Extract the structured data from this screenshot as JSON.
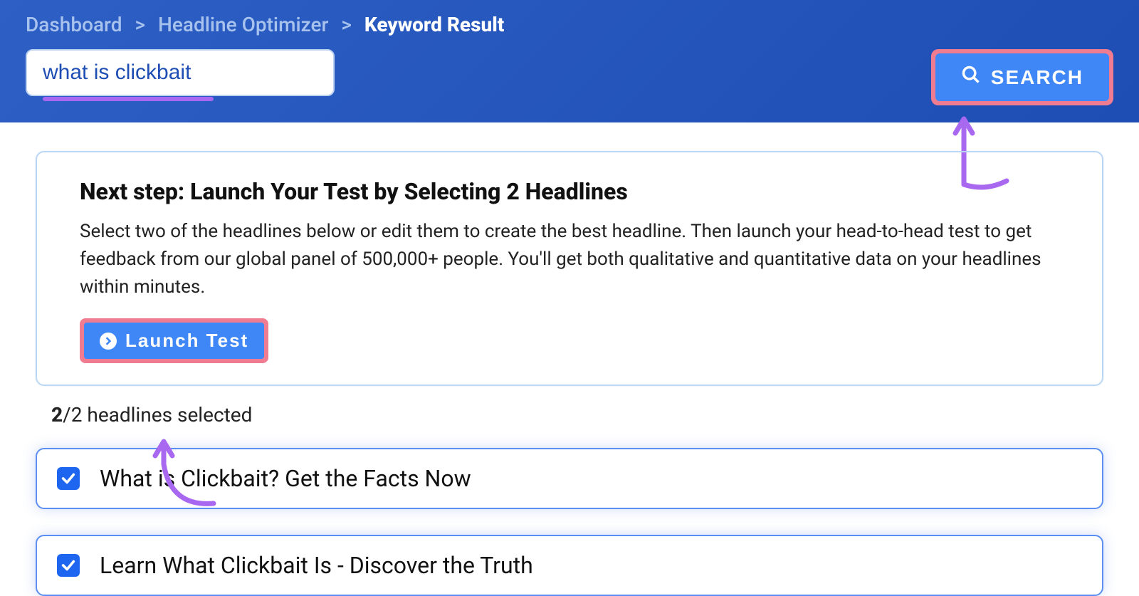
{
  "breadcrumb": {
    "items": [
      "Dashboard",
      "Headline Optimizer"
    ],
    "current": "Keyword Result"
  },
  "search": {
    "value": "what is clickbait",
    "button_label": "SEARCH"
  },
  "next_step": {
    "title": "Next step: Launch Your Test by Selecting 2 Headlines",
    "description": "Select two of the headlines below or edit them to create the best headline. Then launch your head-to-head test to get feedback from our global panel of 500,000+ people. You'll get both qualitative and quantitative data on your headlines within minutes.",
    "launch_label": "Launch Test"
  },
  "selection": {
    "selected_count": "2",
    "total_text": "/2 headlines selected"
  },
  "headlines": [
    {
      "text": "What is Clickbait? Get the Facts Now",
      "checked": true
    },
    {
      "text": "Learn What Clickbait Is - Discover the Truth",
      "checked": true
    }
  ],
  "colors": {
    "accent_blue": "#3f86f6",
    "annotation_pink": "#ef7c91",
    "annotation_purple": "#a868f0"
  }
}
